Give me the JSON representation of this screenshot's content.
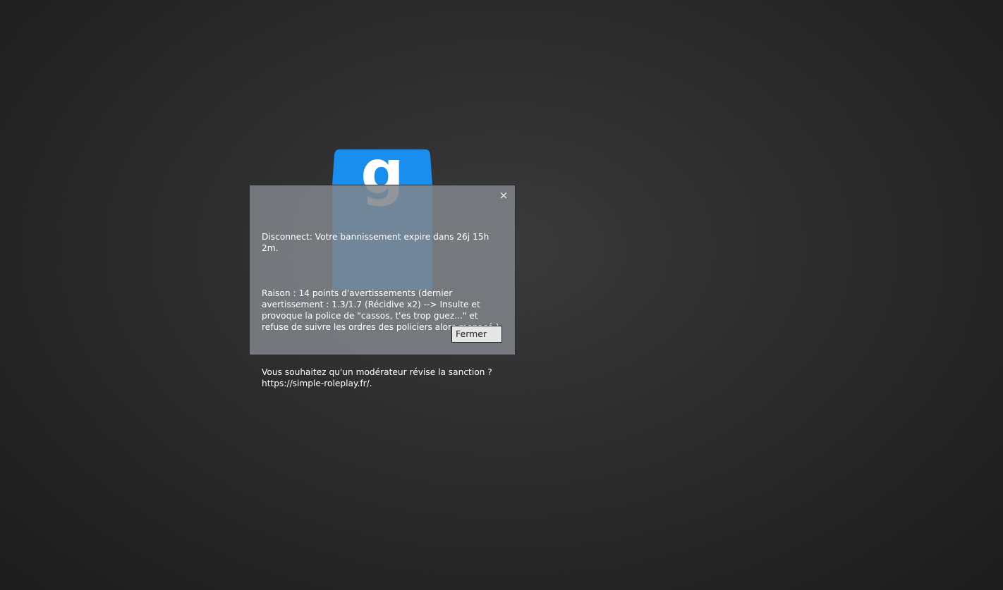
{
  "dialog": {
    "close_symbol": "×",
    "line_disconnect": "Disconnect: Votre bannissement expire dans 26j 15h 2m.",
    "line_raison": "Raison : 14 points d'avertissements (dernier avertissement : 1.3/1.7 (Récidive x2) --> Insulte et provoque la police de \"cassos, t'es trop guez...\" et refuse de suivre les ordres des policiers alors menacé.)",
    "line_appeal": "Vous souhaitez qu'un modérateur révise la sanction ? https://simple-roleplay.fr/.",
    "button_label": "Fermer"
  },
  "logo": {
    "icon": "gmod-logo-icon",
    "glyph": "g",
    "color": "#1a8eef"
  }
}
